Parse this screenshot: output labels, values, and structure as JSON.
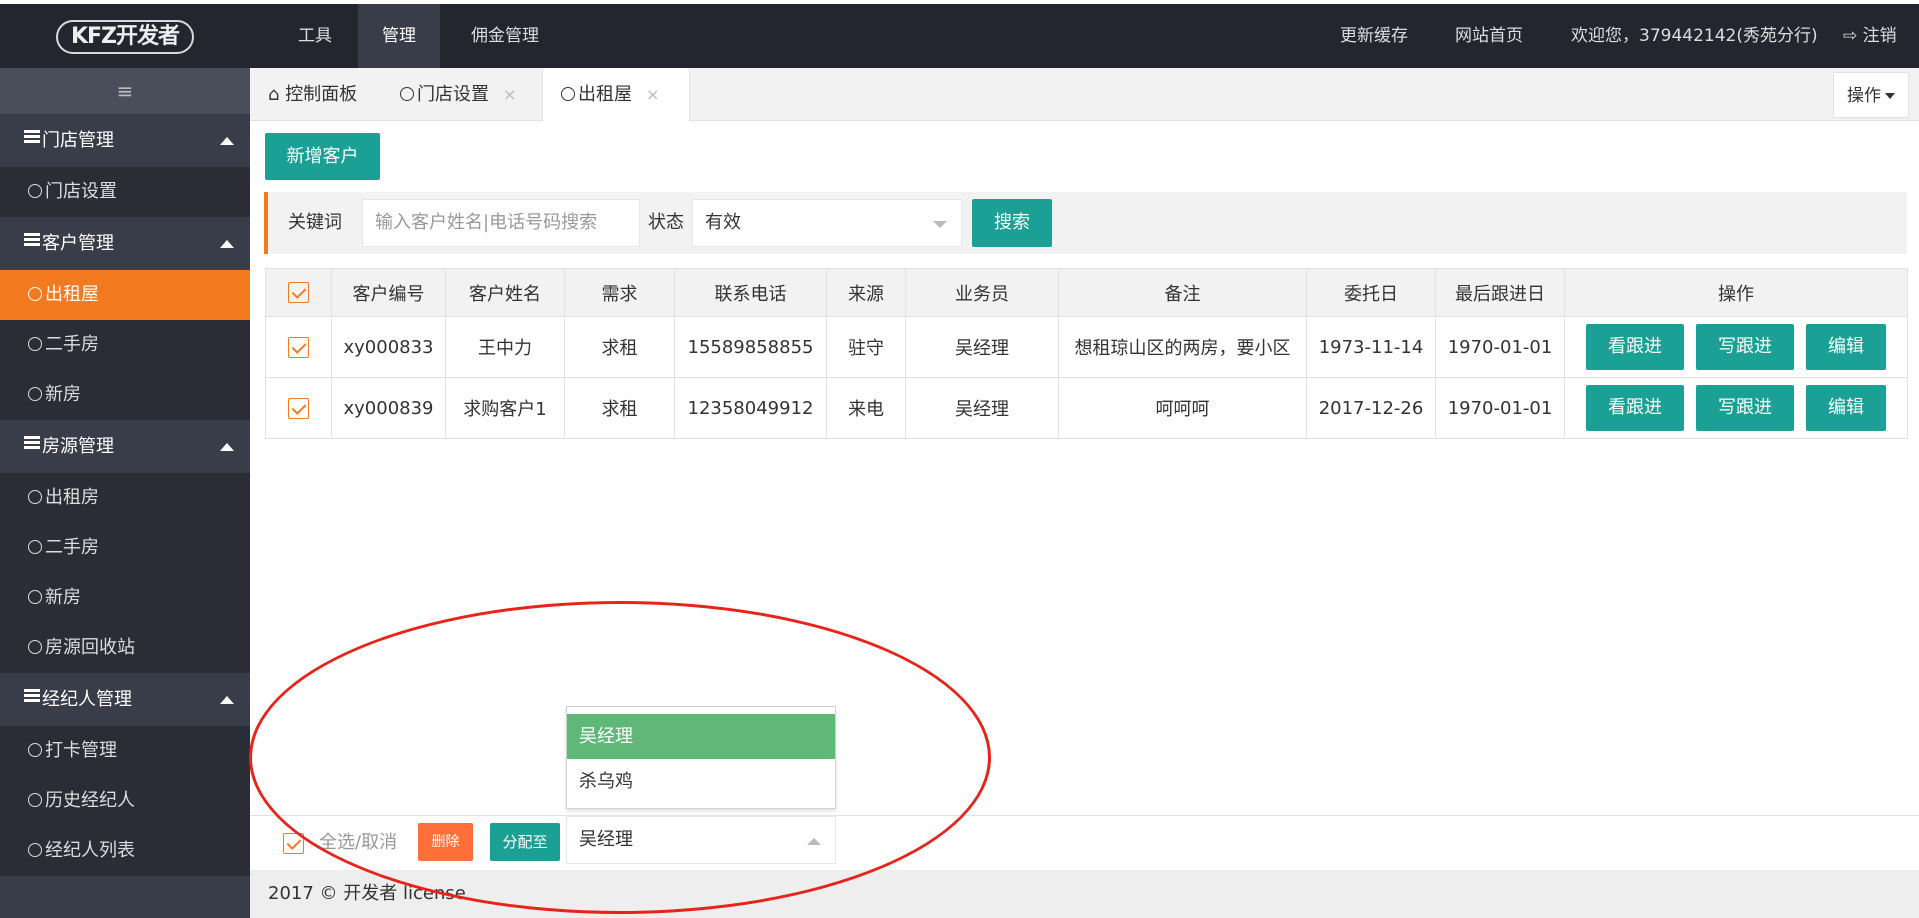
{
  "header": {
    "logo": "KFZ开发者",
    "nav": [
      "工具",
      "管理",
      "佣金管理"
    ],
    "active_nav": "管理",
    "right": {
      "refresh": "更新缓存",
      "home": "网站首页",
      "welcome": "欢迎您，379442142(秀苑分行)",
      "logout": "注销"
    }
  },
  "sidebar": {
    "toggle": "≡",
    "groups": [
      {
        "title": "门店管理",
        "items": [
          "门店设置"
        ]
      },
      {
        "title": "客户管理",
        "items": [
          "出租屋",
          "二手房",
          "新房"
        ]
      },
      {
        "title": "房源管理",
        "items": [
          "出租房",
          "二手房",
          "新房",
          "房源回收站"
        ]
      },
      {
        "title": "经纪人管理",
        "items": [
          "打卡管理",
          "历史经纪人",
          "经纪人列表"
        ]
      }
    ],
    "active_item": "出租屋"
  },
  "tabs": {
    "items": [
      "控制面板",
      "门店设置",
      "出租屋"
    ],
    "active": "出租屋",
    "close": "×",
    "ops": "操作"
  },
  "toolbar": {
    "add_label": "新增客户"
  },
  "search": {
    "keyword_label": "关键词",
    "placeholder": "输入客户姓名|电话号码搜索",
    "status_label": "状态",
    "status_value": "有效",
    "button": "搜索"
  },
  "table": {
    "headers": [
      "客户编号",
      "客户姓名",
      "需求",
      "联系电话",
      "来源",
      "业务员",
      "备注",
      "委托日",
      "最后跟进日",
      "操作"
    ],
    "rows": [
      [
        "xy000833",
        "王中力",
        "求租",
        "15589858855",
        "驻守",
        "吴经理",
        "想租琼山区的两房，要小区",
        "1973-11-14",
        "1970-01-01"
      ],
      [
        "xy000839",
        "求购客户1",
        "求租",
        "12358049912",
        "来电",
        "吴经理",
        "呵呵呵",
        "2017-12-26",
        "1970-01-01"
      ]
    ],
    "row_actions": [
      "看跟进",
      "写跟进",
      "编辑"
    ]
  },
  "bottom": {
    "select_all": "全选/取消",
    "delete": "删除",
    "assign": "分配至",
    "assign_value": "吴经理",
    "options": [
      "吴经理",
      "杀乌鸡"
    ]
  },
  "footer": {
    "text": "2017 © 开发者 license"
  },
  "colors": {
    "accent": "#1aa094",
    "orange": "#f47a20",
    "dark": "#393d49",
    "annotation": "#e8231a"
  }
}
